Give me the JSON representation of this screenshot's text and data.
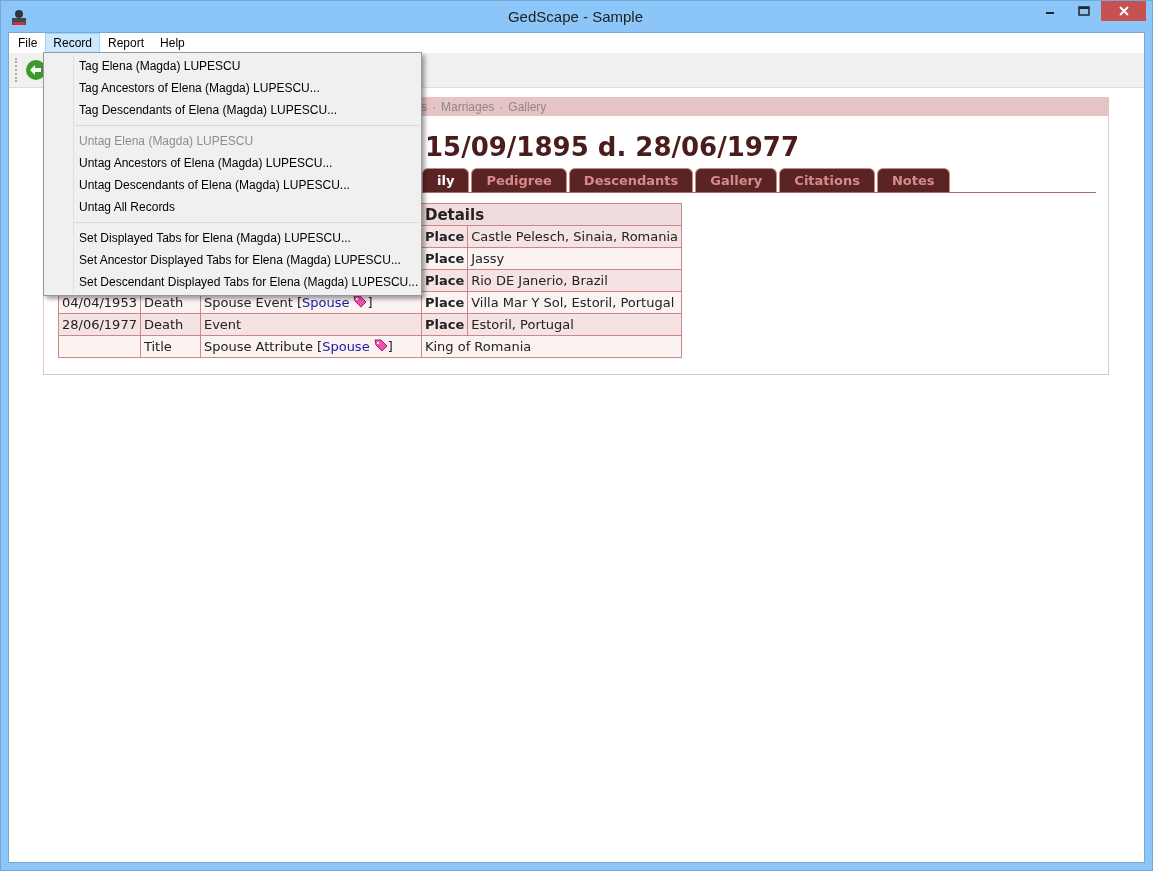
{
  "window": {
    "title": "GedScape - Sample"
  },
  "menubar": [
    {
      "label": "File",
      "selected": false
    },
    {
      "label": "Record",
      "selected": true
    },
    {
      "label": "Report",
      "selected": false
    },
    {
      "label": "Help",
      "selected": false
    }
  ],
  "menu": [
    {
      "kind": "item",
      "label": "Tag Elena (Magda) LUPESCU",
      "disabled": false
    },
    {
      "kind": "item",
      "label": "Tag Ancestors of Elena (Magda) LUPESCU...",
      "disabled": false
    },
    {
      "kind": "item",
      "label": "Tag Descendants of Elena (Magda) LUPESCU...",
      "disabled": false
    },
    {
      "kind": "separator"
    },
    {
      "kind": "item",
      "label": "Untag Elena (Magda) LUPESCU",
      "disabled": true
    },
    {
      "kind": "item",
      "label": "Untag Ancestors of Elena (Magda) LUPESCU...",
      "disabled": false
    },
    {
      "kind": "item",
      "label": "Untag Descendants of Elena (Magda) LUPESCU...",
      "disabled": false
    },
    {
      "kind": "item",
      "label": "Untag All Records",
      "disabled": false
    },
    {
      "kind": "separator"
    },
    {
      "kind": "item",
      "label": "Set Displayed Tabs for Elena (Magda) LUPESCU...",
      "disabled": false
    },
    {
      "kind": "item",
      "label": "Set Ancestor Displayed Tabs for Elena (Magda) LUPESCU...",
      "disabled": false
    },
    {
      "kind": "item",
      "label": "Set Descendant Displayed Tabs for Elena (Magda) LUPESCU...",
      "disabled": false
    }
  ],
  "breadcrumb": {
    "separator": "·",
    "items": [
      "s",
      "Marriages",
      "Gallery"
    ]
  },
  "heading": "15/09/1895 d. 28/06/1977",
  "tabs": [
    {
      "label": "ily",
      "selected": true
    },
    {
      "label": "Pedigree",
      "selected": false
    },
    {
      "label": "Descendants",
      "selected": false
    },
    {
      "label": "Gallery",
      "selected": false
    },
    {
      "label": "Citations",
      "selected": false
    },
    {
      "label": "Notes",
      "selected": false
    }
  ],
  "table": {
    "header": "Details",
    "link_open": "[",
    "link_close": "]",
    "rows": [
      {
        "date": "",
        "type": "",
        "event": "",
        "link": "",
        "detail_label": "Place",
        "detail": "Castle Pelesch, Sinaia, Romania"
      },
      {
        "date": "",
        "type": "",
        "event": "",
        "link": "",
        "detail_label": "Place",
        "detail": "Jassy"
      },
      {
        "date": "",
        "type": "",
        "event": "",
        "link": "",
        "detail_label": "Place",
        "detail": "Rio DE Janerio, Brazil"
      },
      {
        "date": "04/04/1953",
        "type": "Death",
        "event": "Spouse Event",
        "link": "Spouse",
        "detail_label": "Place",
        "detail": "Villa Mar Y Sol, Estoril, Portugal"
      },
      {
        "date": "28/06/1977",
        "type": "Death",
        "event": "Event",
        "link": "",
        "detail_label": "Place",
        "detail": "Estoril, Portugal"
      },
      {
        "date": "",
        "type": "Title",
        "event": "Spouse Attribute",
        "link": "Spouse",
        "detail_label": "",
        "detail": "King of Romania"
      }
    ]
  }
}
